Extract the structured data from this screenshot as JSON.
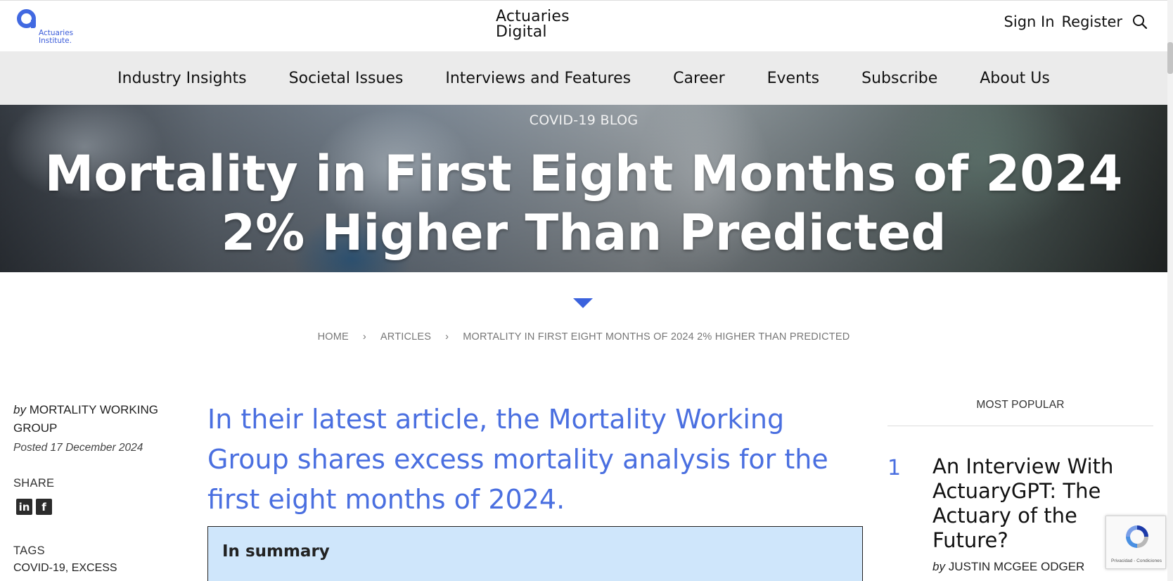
{
  "header": {
    "logo_text_line1": "Actuaries",
    "logo_text_line2": "Institute.",
    "site_title_line1": "Actuaries",
    "site_title_line2": "Digital",
    "sign_in": "Sign In",
    "register": "Register",
    "search_icon": "search-icon"
  },
  "nav": {
    "items": [
      {
        "label": "Industry Insights"
      },
      {
        "label": "Societal Issues"
      },
      {
        "label": "Interviews and Features"
      },
      {
        "label": "Career"
      },
      {
        "label": "Events"
      },
      {
        "label": "Subscribe"
      },
      {
        "label": "About Us"
      }
    ]
  },
  "hero": {
    "kicker": "COVID-19 BLOG",
    "title": "Mortality in First Eight Months of 2024 2% Higher Than Predicted"
  },
  "breadcrumb": {
    "home": "HOME",
    "articles": "ARTICLES",
    "current": "MORTALITY IN FIRST EIGHT MONTHS OF 2024 2% HIGHER THAN PREDICTED",
    "separator": "›"
  },
  "meta": {
    "by": "by",
    "author": "MORTALITY WORKING GROUP",
    "posted": "Posted 17 December 2024",
    "share_label": "SHARE",
    "share_linkedin": "in",
    "share_facebook": "f",
    "tags_label": "TAGS",
    "tags_value": "COVID-19, EXCESS"
  },
  "article": {
    "lead": "In their latest article, the Mortality Working Group shares excess mortality analysis for the first eight months of 2024.",
    "summary_title": "In summary"
  },
  "sidebar": {
    "heading": "MOST POPULAR",
    "items": [
      {
        "rank": "1",
        "title": "An Interview With ActuaryGPT: The Actuary of the Future?",
        "by": "by",
        "author": "JUSTIN MCGEE ODGER"
      }
    ]
  },
  "recaptcha": {
    "text": "Privacidad - Condiciones"
  },
  "colors": {
    "accent": "#4a6fe0",
    "nav_bg": "#ebebeb",
    "summary_bg": "#cfe6fb"
  }
}
